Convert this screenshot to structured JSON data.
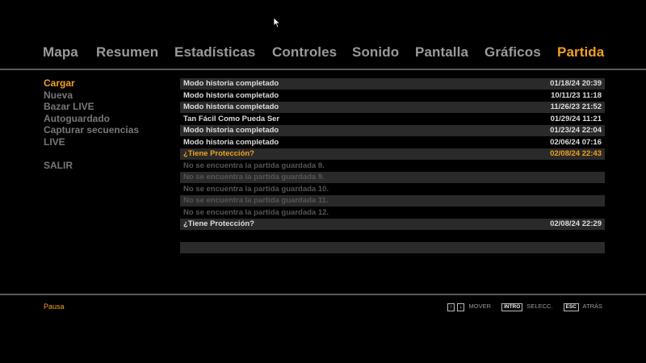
{
  "tabs": [
    "Mapa",
    "Resumen",
    "Estadísticas",
    "Controles",
    "Sonido",
    "Pantalla",
    "Gráficos",
    "Partida"
  ],
  "active_tab": "Partida",
  "menu": {
    "items": [
      "Cargar",
      "Nueva",
      "Bazar LIVE",
      "Autoguardado",
      "Capturar secuencias",
      "LIVE"
    ],
    "exit": "SALIR",
    "active": "Cargar"
  },
  "slots": [
    {
      "name": "Modo historia completado",
      "date": "01/18/24 20:39"
    },
    {
      "name": "Modo historia completado",
      "date": "10/11/23 11:18"
    },
    {
      "name": "Modo historia completado",
      "date": "11/26/23 21:52"
    },
    {
      "name": "Tan Fácil Como Pueda Ser",
      "date": "01/29/24 11:21"
    },
    {
      "name": "Modo historia completado",
      "date": "01/23/24 22:04"
    },
    {
      "name": "Modo historia completado",
      "date": "02/06/24 07:16"
    },
    {
      "name": "¿Tiene Protección?",
      "date": "02/08/24 22:43",
      "selected": true
    },
    {
      "name": "No se encuentra la partida guardada 8.",
      "date": "",
      "empty": true
    },
    {
      "name": "No se encuentra la partida guardada 9.",
      "date": "",
      "empty": true
    },
    {
      "name": "No se encuentra la partida guardada 10.",
      "date": "",
      "empty": true
    },
    {
      "name": "No se encuentra la partida guardada 11.",
      "date": "",
      "empty": true
    },
    {
      "name": "No se encuentra la partida guardada 12.",
      "date": "",
      "empty": true
    },
    {
      "name": "¿Tiene Protección?",
      "date": "02/08/24 22:29"
    }
  ],
  "footer": {
    "status": "Pausa",
    "hints": [
      {
        "keys": [
          "↑",
          "↓"
        ],
        "label": "MOVER"
      },
      {
        "keys": [
          "INTRO"
        ],
        "label": "SELECC."
      },
      {
        "keys": [
          "ESC"
        ],
        "label": "ATRÁS"
      }
    ]
  },
  "colors": {
    "accent": "#f0a020",
    "row_dark": "#2a2a2a",
    "text": "#dddddd",
    "muted": "#777777"
  }
}
